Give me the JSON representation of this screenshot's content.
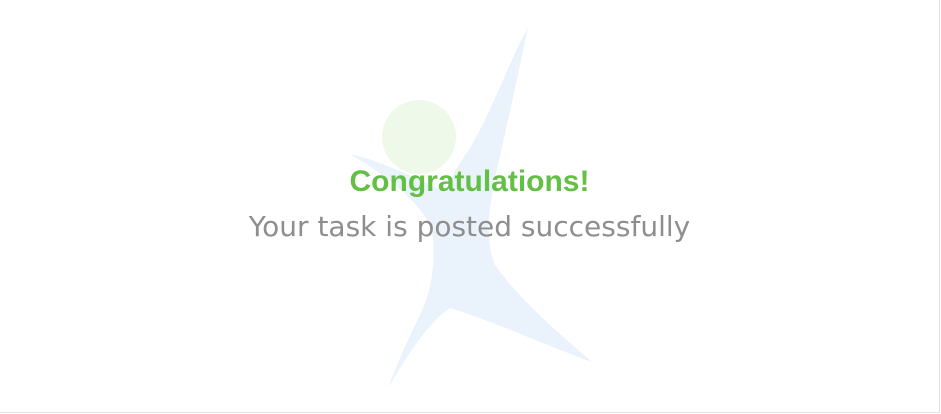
{
  "success_panel": {
    "headline": "Congratulations!",
    "message": "Your task is posted successfully",
    "illustration_icon": "celebrating-person-icon",
    "colors": {
      "headline": "#63bf45",
      "message": "#8e8e8e",
      "figure_body": "#eaf2fb",
      "figure_head": "#eef9ea"
    }
  }
}
